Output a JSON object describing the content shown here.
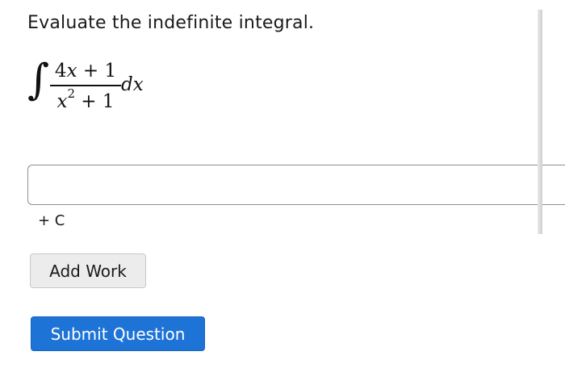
{
  "question": {
    "prompt": "Evaluate the indefinite integral.",
    "integral": {
      "sign": "∫",
      "numerator": {
        "coef": "4",
        "var": "x",
        "rest": " + 1"
      },
      "denominator": {
        "var": "x",
        "exponent": "2",
        "rest": " + 1"
      },
      "differential": "dx"
    }
  },
  "answer": {
    "value": "",
    "placeholder": "",
    "suffix": "+ C"
  },
  "buttons": {
    "add_work": "Add Work",
    "submit": "Submit Question"
  },
  "colors": {
    "submit_bg": "#1e74d6",
    "add_work_bg": "#ececec",
    "input_border": "#8f8f8f"
  }
}
